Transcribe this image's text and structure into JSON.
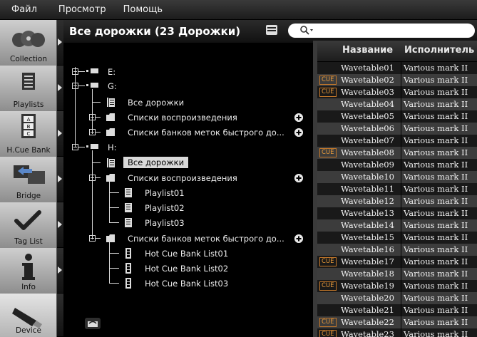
{
  "menu": [
    "Файл",
    "Просмотр",
    "Помощь"
  ],
  "sidebar": {
    "items": [
      {
        "label": "Collection",
        "icon": "collection-icon"
      },
      {
        "label": "Playlists",
        "icon": "playlists-icon"
      },
      {
        "label": "H.Cue Bank",
        "icon": "hot-cue-bank-icon"
      },
      {
        "label": "Bridge",
        "icon": "bridge-icon"
      },
      {
        "label": "Tag List",
        "icon": "check-icon"
      },
      {
        "label": "Info",
        "icon": "info-icon"
      },
      {
        "label": "Device",
        "icon": "usb-device-icon"
      }
    ]
  },
  "header": {
    "title": "Все дорожки (23 Дорожки)"
  },
  "tree": {
    "drive_e": "E:",
    "drive_g": "G:",
    "g_all_tracks": "Все дорожки",
    "g_playlists": "Списки воспроизведения",
    "g_cue_banks": "Списки банков меток быстрого до...",
    "drive_h": "H:",
    "h_all_tracks": "Все дорожки",
    "h_playlists": "Списки воспроизведения",
    "playlist_1": "Playlist01",
    "playlist_2": "Playlist02",
    "playlist_3": "Playlist03",
    "h_cue_banks": "Списки банков меток быстрого до...",
    "cue_bank_1": "Hot Cue Bank List01",
    "cue_bank_2": "Hot Cue Bank List02",
    "cue_bank_3": "Hot Cue Bank List03"
  },
  "table": {
    "columns": [
      "Название",
      "Исполнитель"
    ],
    "cue_label": "CUE",
    "rows": [
      {
        "cue": false,
        "name": "Wavetable01",
        "artist": "Various mark II"
      },
      {
        "cue": true,
        "name": "Wavetable02",
        "artist": "Various mark II"
      },
      {
        "cue": true,
        "name": "Wavetable03",
        "artist": "Various mark II"
      },
      {
        "cue": false,
        "name": "Wavetable04",
        "artist": "Various mark II"
      },
      {
        "cue": false,
        "name": "Wavetable05",
        "artist": "Various mark II"
      },
      {
        "cue": false,
        "name": "Wavetable06",
        "artist": "Various mark II"
      },
      {
        "cue": false,
        "name": "Wavetable07",
        "artist": "Various mark II"
      },
      {
        "cue": true,
        "name": "Wavetable08",
        "artist": "Various mark II"
      },
      {
        "cue": false,
        "name": "Wavetable09",
        "artist": "Various mark II"
      },
      {
        "cue": false,
        "name": "Wavetable10",
        "artist": "Various mark II"
      },
      {
        "cue": false,
        "name": "Wavetable11",
        "artist": "Various mark II"
      },
      {
        "cue": false,
        "name": "Wavetable12",
        "artist": "Various mark II"
      },
      {
        "cue": false,
        "name": "Wavetable13",
        "artist": "Various mark II"
      },
      {
        "cue": false,
        "name": "Wavetable14",
        "artist": "Various mark II"
      },
      {
        "cue": false,
        "name": "Wavetable15",
        "artist": "Various mark II"
      },
      {
        "cue": false,
        "name": "Wavetable16",
        "artist": "Various mark II"
      },
      {
        "cue": true,
        "name": "Wavetable17",
        "artist": "Various mark II"
      },
      {
        "cue": false,
        "name": "Wavetable18",
        "artist": "Various mark II"
      },
      {
        "cue": true,
        "name": "Wavetable19",
        "artist": "Various mark II"
      },
      {
        "cue": false,
        "name": "Wavetable20",
        "artist": "Various mark II"
      },
      {
        "cue": false,
        "name": "Wavetable21",
        "artist": "Various mark II"
      },
      {
        "cue": true,
        "name": "Wavetable22",
        "artist": "Various mark II"
      },
      {
        "cue": true,
        "name": "Wavetable23",
        "artist": "Various mark II"
      }
    ]
  }
}
